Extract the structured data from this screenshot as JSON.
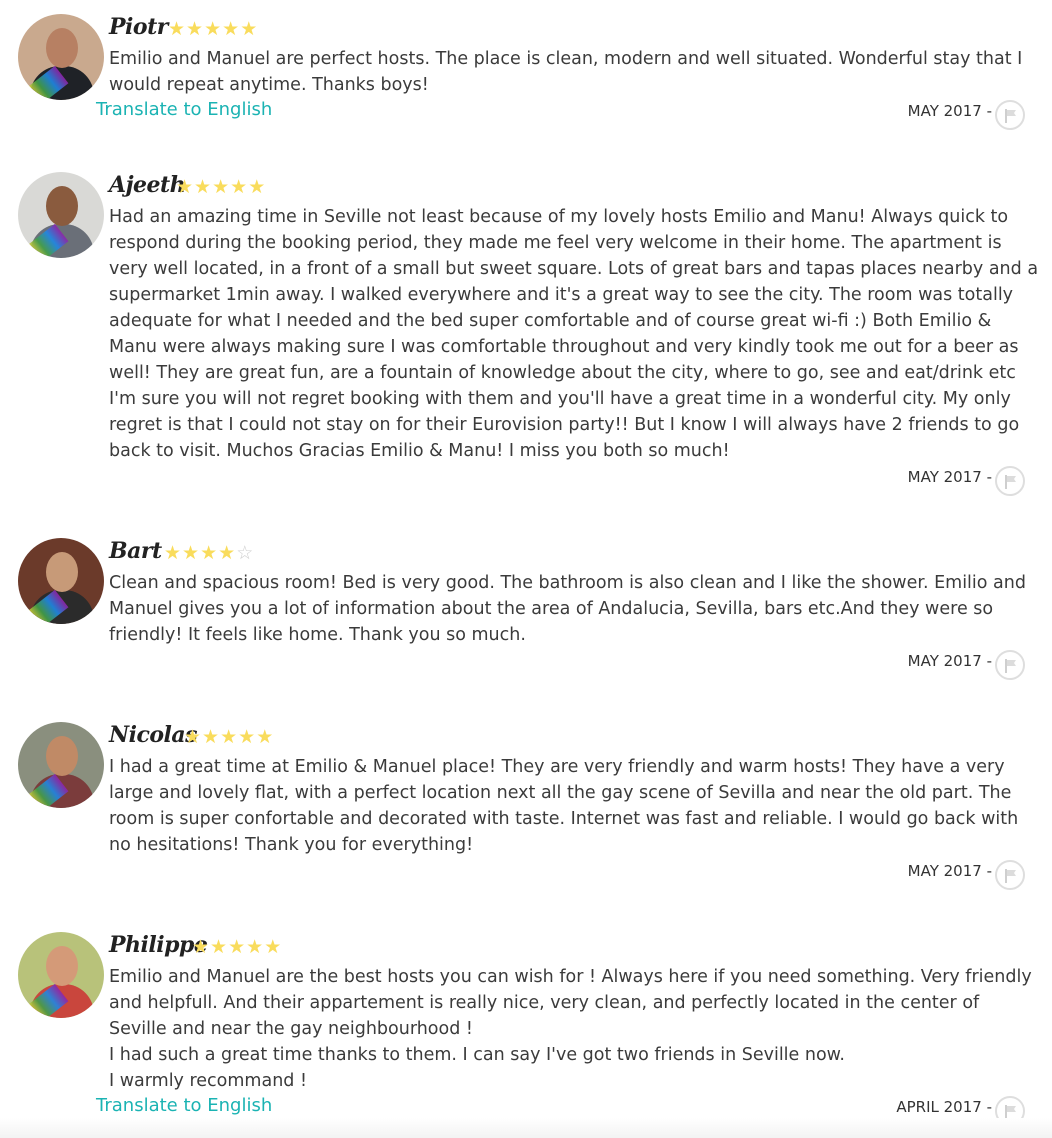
{
  "reviews": [
    {
      "name": "Piotr",
      "rating": 5,
      "text": "Emilio and Manuel are perfect hosts. The place is clean, modern and well situated. Wonderful stay that I would repeat anytime. Thanks boys!",
      "translate_label": "Translate to English",
      "date": "MAY 2017 -",
      "avatar_colors": {
        "bg": "#c9a98e",
        "skin": "#b78063",
        "shirt": "#1f2227"
      }
    },
    {
      "name": "Ajeeth",
      "rating": 5,
      "text": "Had an amazing time in Seville not least because of my lovely hosts Emilio and Manu! Always quick to respond during the booking period, they made me feel very welcome in their home. The apartment is very well located, in a front of a small but sweet square. Lots of great bars and tapas places nearby and a supermarket 1min away. I walked everywhere and it's a great way to see the city. The room was totally adequate for what I needed and the bed super comfortable and of course great wi-fi :) Both Emilio & Manu were always making sure I was comfortable throughout and very kindly took me out for a beer as well! They are great fun, are a fountain of knowledge about the city, where to go, see and eat/drink etc I'm sure you will not regret booking with them and you'll have a great time in a wonderful city. My only regret is that I could not stay on for their Eurovision party!! But I know I will always have 2 friends to go back to visit. Muchos Gracias Emilio & Manu! I miss you both so much!",
      "translate_label": "",
      "date": "MAY 2017 -",
      "avatar_colors": {
        "bg": "#d9d9d6",
        "skin": "#8a5b3e",
        "shirt": "#6a6f78"
      }
    },
    {
      "name": "Bart",
      "rating": 4,
      "text": "Clean and spacious room! Bed is very good. The bathroom is also clean and I like the shower. Emilio and Manuel gives you a lot of information about the area of Andalucia, Sevilla, bars etc.And they were so friendly! It feels like home. Thank you so much.",
      "translate_label": "",
      "date": "MAY 2017 -",
      "avatar_colors": {
        "bg": "#6b3a2a",
        "skin": "#c79a78",
        "shirt": "#2b2b2b"
      }
    },
    {
      "name": "Nicolas",
      "rating": 5,
      "text": "I had a great time at Emilio & Manuel place! They are very friendly and warm hosts! They have a very large and lovely flat, with a perfect location next all the gay scene of Sevilla and near the old part. The room is super confortable and decorated with taste. Internet was fast and reliable. I would go back with no hesitations! Thank you for everything!",
      "translate_label": "",
      "date": "MAY 2017 -",
      "avatar_colors": {
        "bg": "#8a8f7e",
        "skin": "#c08a66",
        "shirt": "#7b3c3c"
      }
    },
    {
      "name": "Philippe",
      "rating": 5,
      "text": "Emilio and Manuel are the best hosts you can wish for ! Always here if you need something. Very friendly and helpfull. And their appartement is really nice, very clean, and perfectly located in the center of Seville and near the gay neighbourhood !\nI had such a great time thanks to them. I can say I've got two friends in Seville now.\nI warmly recommand !",
      "translate_label": "Translate to English",
      "date": "APRIL 2017 -",
      "avatar_colors": {
        "bg": "#b8c27a",
        "skin": "#d49a78",
        "shirt": "#c9463d"
      }
    }
  ],
  "colors": {
    "star_filled": "#f9dc5c",
    "star_empty": "#cfcfcf",
    "link": "#1bb3b3",
    "text": "#3b3b3b"
  },
  "icons": {
    "flag": "flag-icon",
    "star": "star-icon"
  }
}
